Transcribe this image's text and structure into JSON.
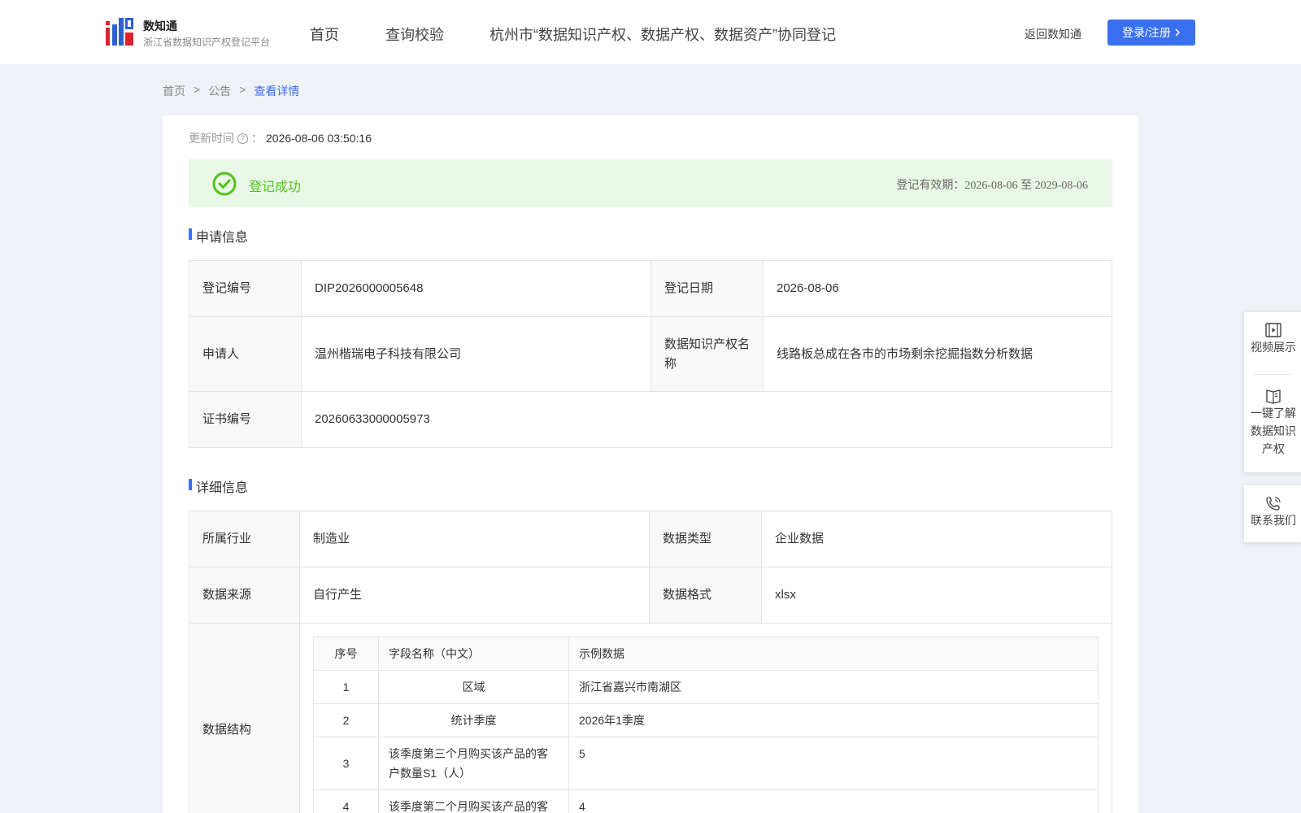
{
  "header": {
    "brand_name": "数知通",
    "brand_sub": "浙江省数据知识产权登记平台",
    "nav": [
      "首页",
      "查询校验",
      "杭州市“数据知识产权、数据产权、数据资产”协同登记"
    ],
    "back_link": "返回数知通",
    "login_label": "登录/注册",
    "accent_color": "#3a6ff0"
  },
  "breadcrumb": {
    "items": [
      "首页",
      "公告",
      "查看详情"
    ],
    "separator": ">"
  },
  "update": {
    "label": "更新时间",
    "colon": "：",
    "value": "2026-08-06 03:50:16"
  },
  "status": {
    "text": "登记成功",
    "validity_label": "登记有效期：",
    "validity_value": "2026-08-06 至 2029-08-06",
    "color": "#52c41a"
  },
  "apply_section": {
    "title": "申请信息",
    "reg_no_label": "登记编号",
    "reg_no": "DIP2026000005648",
    "reg_date_label": "登记日期",
    "reg_date": "2026-08-06",
    "applicant_label": "申请人",
    "applicant": "温州楷瑞电子科技有限公司",
    "ip_name_label": "数据知识产权名称",
    "ip_name": "线路板总成在各市的市场剩余挖掘指数分析数据",
    "cert_no_label": "证书编号",
    "cert_no": "20260633000005973"
  },
  "detail_section": {
    "title": "详细信息",
    "industry_label": "所属行业",
    "industry": "制造业",
    "data_type_label": "数据类型",
    "data_type": "企业数据",
    "source_label": "数据来源",
    "source": "自行产生",
    "format_label": "数据格式",
    "format": "xlsx",
    "structure_label": "数据结构",
    "structure_headers": [
      "序号",
      "字段名称（中文）",
      "示例数据"
    ],
    "structure_rows": [
      {
        "idx": "1",
        "name": "区域",
        "sample": "浙江省嘉兴市南湖区"
      },
      {
        "idx": "2",
        "name": "统计季度",
        "sample": "2026年1季度"
      },
      {
        "idx": "3",
        "name": "该季度第三个月购买该产品的客户数量S1（人）",
        "sample": "5"
      },
      {
        "idx": "4",
        "name": "该季度第二个月购买该产品的客",
        "sample": "4"
      }
    ]
  },
  "side_panel": {
    "video": "视频展示",
    "learn": [
      "一键了解",
      "数据知识",
      "产权"
    ],
    "contact": "联系我们"
  }
}
